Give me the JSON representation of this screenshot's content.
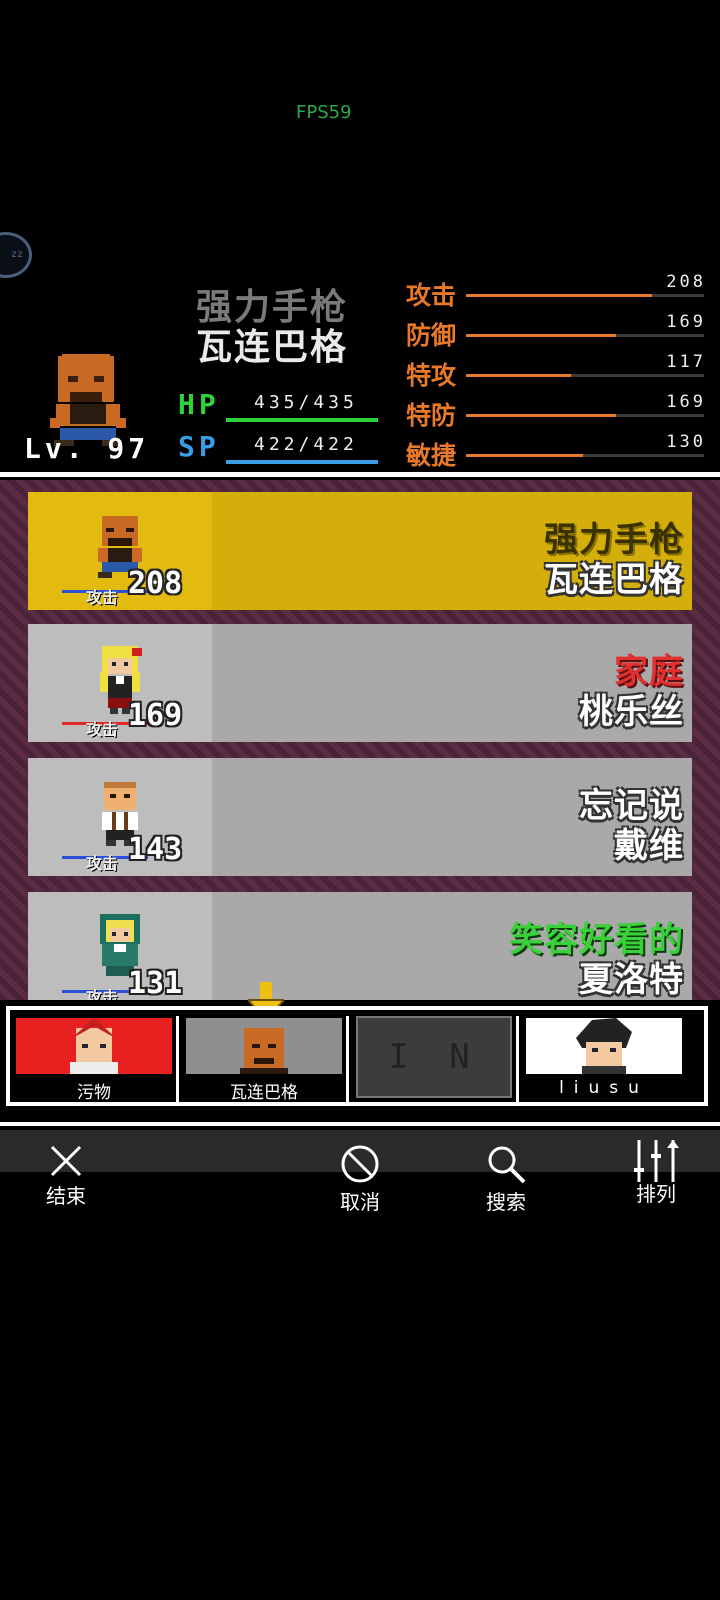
{
  "fps": "FPS59",
  "float_button": "zz",
  "hero": {
    "title_line1": "强力手枪",
    "title_line2": "瓦连巴格",
    "level": "Lv. 97",
    "hp_label": "HP",
    "hp_value": "435/435",
    "hp_fill": 1.0,
    "sp_label": "SP",
    "sp_value": "422/422",
    "sp_fill": 1.0,
    "stats": [
      {
        "label": "攻击",
        "value": "208",
        "fill": 0.78
      },
      {
        "label": "防御",
        "value": "169",
        "fill": 0.63
      },
      {
        "label": "特攻",
        "value": "117",
        "fill": 0.44
      },
      {
        "label": "特防",
        "value": "169",
        "fill": 0.63
      },
      {
        "label": "敏捷",
        "value": "130",
        "fill": 0.49
      }
    ]
  },
  "list": [
    {
      "atk_label": "攻击",
      "atk_value": "208",
      "name1": "强力手枪",
      "name2": "瓦连巴格",
      "selected": true
    },
    {
      "atk_label": "攻击",
      "atk_value": "169",
      "name1": "家庭",
      "name2": "桃乐丝",
      "selected": false
    },
    {
      "atk_label": "攻击",
      "atk_value": "143",
      "name1": "忘记说",
      "name2": "戴维",
      "selected": false
    },
    {
      "atk_label": "攻击",
      "atk_value": "131",
      "name1": "笑容好看的",
      "name2": "夏洛特",
      "selected": false
    }
  ],
  "party": [
    {
      "name": "污物"
    },
    {
      "name": "瓦连巴格"
    },
    {
      "name": "",
      "empty_label": "I N"
    },
    {
      "name": "liusu"
    }
  ],
  "toolbar": {
    "close": "结束",
    "cancel": "取消",
    "search": "搜索",
    "sort": "排列"
  },
  "colors": {
    "selected_card": "#d4ae0a",
    "normal_card": "#a9a9a9",
    "stat_orange": "#e8782a",
    "hp_green": "#2ed23a",
    "sp_blue": "#3a9ee6"
  }
}
